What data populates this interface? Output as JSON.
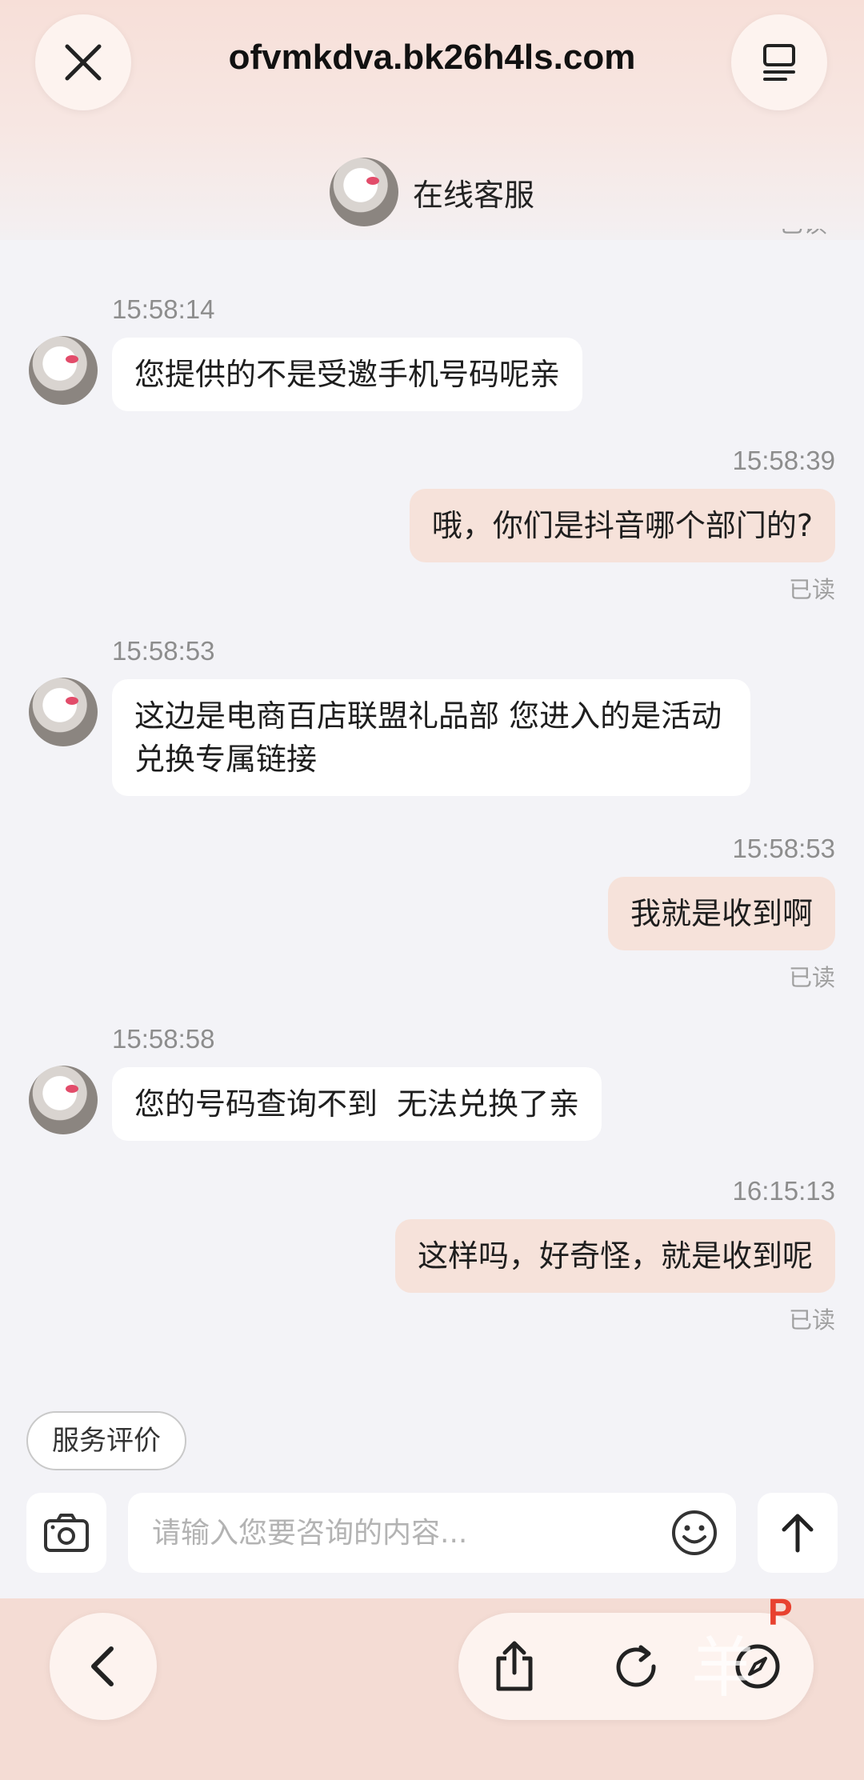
{
  "browser": {
    "url": "ofvmkdva.bk26h4ls.com",
    "close_icon": "close-icon",
    "menu_icon": "menu-icon"
  },
  "header": {
    "agent_name": "在线客服"
  },
  "top_read_fragment": "已读",
  "messages": [
    {
      "side": "in",
      "time": "15:58:14",
      "text": "您提供的不是受邀手机号码呢亲"
    },
    {
      "side": "out",
      "time": "15:58:39",
      "text": "哦，你们是抖音哪个部门的?",
      "status": "已读"
    },
    {
      "side": "in",
      "time": "15:58:53",
      "text": "这边是电商百店联盟礼品部 您进入的是活动兑换专属链接"
    },
    {
      "side": "out",
      "time": "15:58:53",
      "text": "我就是收到啊",
      "status": "已读"
    },
    {
      "side": "in",
      "time": "15:58:58",
      "text": "您的号码查询不到  无法兑换了亲"
    },
    {
      "side": "out",
      "time": "16:15:13",
      "text": "这样吗，好奇怪，就是收到呢",
      "status": "已读"
    }
  ],
  "actions": {
    "rate_label": "服务评价"
  },
  "composer": {
    "placeholder": "请输入您要咨询的内容..."
  },
  "watermark": {
    "text": "羊",
    "badge": "P"
  },
  "colors": {
    "accent_bubble": "#f6e2da",
    "header_bg": "#f7dfd8",
    "background": "#f3f3f7"
  }
}
